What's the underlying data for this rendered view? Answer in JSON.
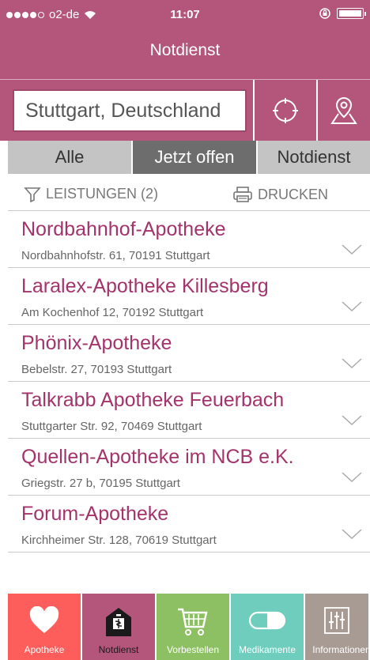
{
  "status_bar": {
    "carrier": "o2-de",
    "time": "11:07"
  },
  "header": {
    "title": "Notdienst"
  },
  "search": {
    "value": "Stuttgart, Deutschland"
  },
  "segments": [
    {
      "label": "Alle",
      "active": false
    },
    {
      "label": "Jetzt offen",
      "active": true
    },
    {
      "label": "Notdienst",
      "active": false
    }
  ],
  "filters": {
    "services_label": "LEISTUNGEN (2)",
    "print_label": "DRUCKEN"
  },
  "pharmacies": [
    {
      "name": "Nordbahnhof-Apotheke",
      "address": "Nordbahnhofstr. 61, 70191 Stuttgart"
    },
    {
      "name": "Laralex-Apotheke Killesberg",
      "address": "Am Kochenhof 12, 70192 Stuttgart"
    },
    {
      "name": "Phönix-Apotheke",
      "address": "Bebelstr. 27, 70193 Stuttgart"
    },
    {
      "name": "Talkrabb Apotheke Feuerbach",
      "address": "Stuttgarter Str. 92, 70469 Stuttgart"
    },
    {
      "name": "Quellen-Apotheke im NCB e.K.",
      "address": "Griegstr. 27 b, 70195 Stuttgart"
    },
    {
      "name": "Forum-Apotheke",
      "address": "Kirchheimer Str. 128, 70619 Stuttgart"
    }
  ],
  "tabs": [
    {
      "label": "Apotheke",
      "color": "#fd5e5b",
      "icon": "heart-icon"
    },
    {
      "label": "Notdienst",
      "color": "#b4557c",
      "icon": "emergency-pharmacy-icon"
    },
    {
      "label": "Vorbestellen",
      "color": "#8cc063",
      "icon": "cart-icon"
    },
    {
      "label": "Medikamente",
      "color": "#6fcdbd",
      "icon": "pill-icon"
    },
    {
      "label": "Informationen",
      "color": "#a79b94",
      "icon": "sliders-icon"
    }
  ],
  "colors": {
    "brand": "#b4557c",
    "pharmacy_name": "#a3336b",
    "segment_active": "#6d6d6d",
    "segment_inactive": "#c4c4c4"
  }
}
